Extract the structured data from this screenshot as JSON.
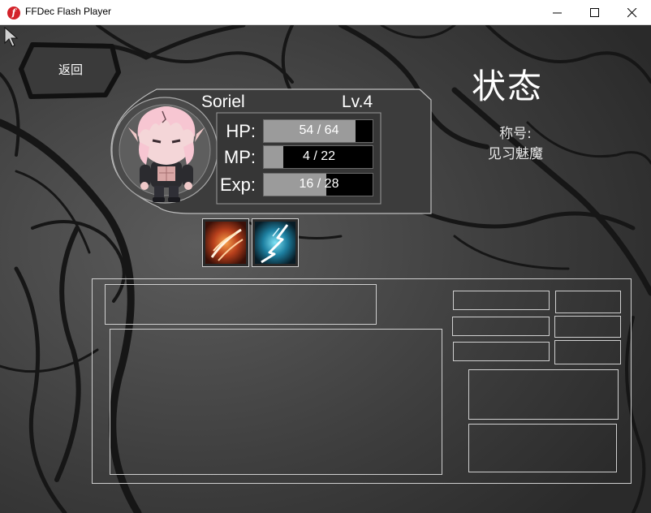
{
  "window": {
    "title": "FFDec Flash Player",
    "icon": "flash-icon",
    "controls": [
      "minimize-icon",
      "maximize-icon",
      "close-icon"
    ]
  },
  "back_button": {
    "label": "返回"
  },
  "screen_title": "状态",
  "character": {
    "name": "Soriel",
    "level": "Lv.4",
    "title_label": "称号:",
    "title_value": "见习魅魔"
  },
  "stats": [
    {
      "label": "HP:",
      "text": "54 / 64",
      "current": 54,
      "max": 64
    },
    {
      "label": "MP:",
      "text": "4 / 22",
      "current": 4,
      "max": 22
    },
    {
      "label": "Exp:",
      "text": "16 / 28",
      "current": 16,
      "max": 28
    }
  ],
  "skills": [
    {
      "icon": "slash-skill-icon",
      "accent": "#e8642a"
    },
    {
      "icon": "lightning-skill-icon",
      "accent": "#29b6d8"
    }
  ],
  "colors": {
    "stage_background": "#3b3b3b",
    "panel_border": "#cfcfcf",
    "bar_fill": "#9b9b9b",
    "bar_background": "#000000"
  }
}
